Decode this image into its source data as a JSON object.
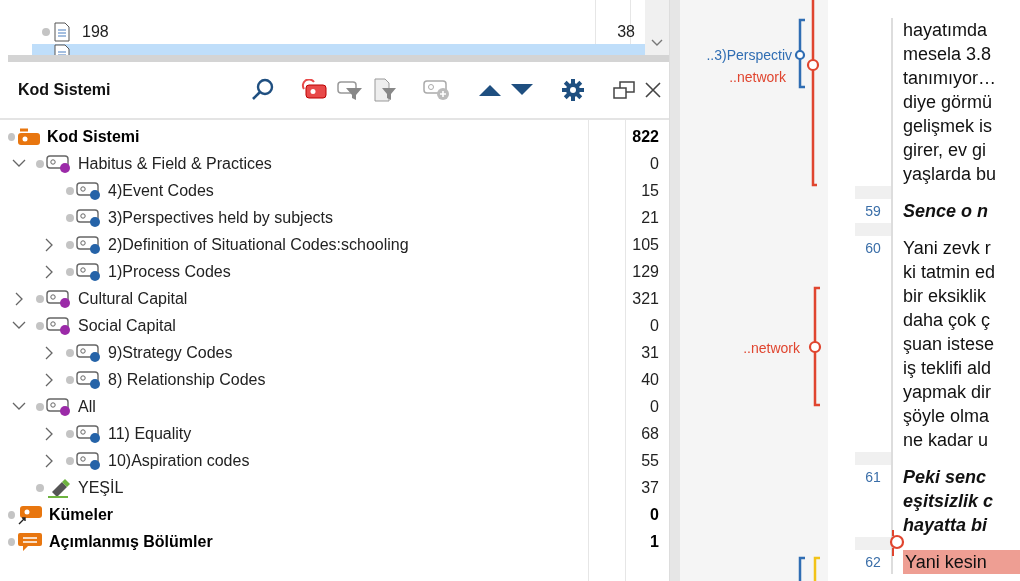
{
  "documents": {
    "rows": [
      {
        "name": "198",
        "count": "38",
        "selected": false
      },
      {
        "selected": true
      }
    ]
  },
  "code_panel": {
    "title": "Kod Sistemi",
    "tree": [
      {
        "kind": "root",
        "label": "Kod Sistemi",
        "count": "822",
        "children": [
          {
            "kind": "code",
            "label": "Habitus & Field & Practices",
            "count": "0",
            "color": "#9b2aa8",
            "expanded": true,
            "children": [
              {
                "kind": "code",
                "label": "4)Event Codes",
                "count": "15",
                "color": "#2563a8"
              },
              {
                "kind": "code",
                "label": "3)Perspectives held by subjects",
                "count": "21",
                "color": "#2563a8"
              },
              {
                "kind": "code",
                "label": "2)Definition of Situational Codes:schooling",
                "count": "105",
                "color": "#2563a8",
                "expanded": false
              },
              {
                "kind": "code",
                "label": "1)Process Codes",
                "count": "129",
                "color": "#2563a8",
                "expanded": false
              }
            ]
          },
          {
            "kind": "code",
            "label": "Cultural Capital",
            "count": "321",
            "color": "#9b2aa8",
            "expanded": false
          },
          {
            "kind": "code",
            "label": "Social Capital",
            "count": "0",
            "color": "#9b2aa8",
            "expanded": true,
            "children": [
              {
                "kind": "code",
                "label": "9)Strategy Codes",
                "count": "31",
                "color": "#2563a8",
                "expanded": false
              },
              {
                "kind": "code",
                "label": "8) Relationship Codes",
                "count": "40",
                "color": "#2563a8",
                "expanded": false
              }
            ]
          },
          {
            "kind": "code",
            "label": "All",
            "count": "0",
            "color": "#9b2aa8",
            "expanded": true,
            "children": [
              {
                "kind": "code",
                "label": "11) Equality",
                "count": "68",
                "color": "#2563a8",
                "expanded": false
              },
              {
                "kind": "code",
                "label": "10)Aspiration codes",
                "count": "55",
                "color": "#2563a8",
                "expanded": false
              }
            ]
          },
          {
            "kind": "highlighter",
            "label": "YEŞİL",
            "count": "37"
          }
        ]
      },
      {
        "kind": "sets",
        "label": "Kümeler",
        "count": "0"
      },
      {
        "kind": "memos",
        "label": "Açımlanmış Bölümler",
        "count": "1"
      }
    ]
  },
  "document": {
    "codings": [
      {
        "label": "..3)Perspectiv",
        "color": "#2f6db3"
      },
      {
        "label": "..network",
        "color": "#e0452f"
      },
      {
        "label": "..network",
        "color": "#e0452f"
      },
      {
        "color": "#2f6db3"
      },
      {
        "color": "#f2c318"
      }
    ],
    "paragraphs": [
      {
        "kind": "answer",
        "lines": [
          "hayatımda",
          "mesela 3.8",
          "tanımıyor…",
          "diye görmü",
          "gelişmek is",
          "girer, ev gi",
          "yaşlarda bu"
        ]
      },
      {
        "kind": "question",
        "number": "59",
        "lines": [
          "Sence o n"
        ]
      },
      {
        "kind": "answer",
        "number": "60",
        "lines": [
          "Yani zevk r",
          "ki tatmin ed",
          "bir eksiklik",
          "daha çok ç",
          "şuan istese",
          "iş teklifi ald",
          "yapmak dir",
          "şöyle olma",
          "ne kadar u"
        ]
      },
      {
        "kind": "question",
        "number": "61",
        "lines": [
          "Peki senc",
          "eşitsizlik c",
          "hayatta bi"
        ]
      },
      {
        "kind": "answer",
        "number": "62",
        "highlighted": true,
        "lines": [
          "Yani kesin"
        ]
      }
    ]
  }
}
